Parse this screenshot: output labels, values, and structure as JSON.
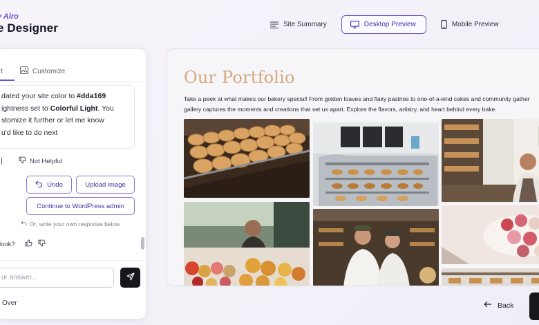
{
  "brand": {
    "small": "y Airo",
    "title": "e Designer"
  },
  "topnav": {
    "site_summary": "Site Summary",
    "desktop_preview": "Desktop Preview",
    "mobile_preview": "Mobile Preview"
  },
  "chat": {
    "tab_active": "t",
    "tab_customize": "Customize",
    "message": {
      "line1_pre": "dated your site color to ",
      "line1_bold": "#dda169",
      "line2_pre": "ightness set to ",
      "line2_bold": "Colorful Light",
      "line2_post": ". You",
      "line3": "stomize it further or let me know",
      "line4": "u'd like to do next"
    },
    "not_helpful": "Not Helpful",
    "undo": "Undo",
    "upload_image": "Upload image",
    "continue_wp": "Continue to WordPress admin",
    "hint": "Or, write your own response below",
    "look": "look?",
    "answer_placeholder": "ur answer...",
    "over": "Over"
  },
  "preview": {
    "title": "Our Portfolio",
    "text_line1": "Take a peek at what makes our bakery special! From golden loaves and flaky pastries to one-of-a-kind cakes and community gather",
    "text_line2": "gallery captures the moments and creations that set us apart. Explore the flavors, artistry, and heart behind every bake."
  },
  "footer": {
    "back": "Back"
  },
  "colors": {
    "accent": "#6a55c8",
    "site_color": "#dda169",
    "title_color": "#d7a77e"
  },
  "icons": [
    "list-icon",
    "monitor-icon",
    "phone-icon",
    "image-icon",
    "thumbs-down-icon",
    "undo-icon",
    "reply-icon",
    "thumbs-up-icon",
    "send-icon",
    "arrow-left-icon"
  ]
}
